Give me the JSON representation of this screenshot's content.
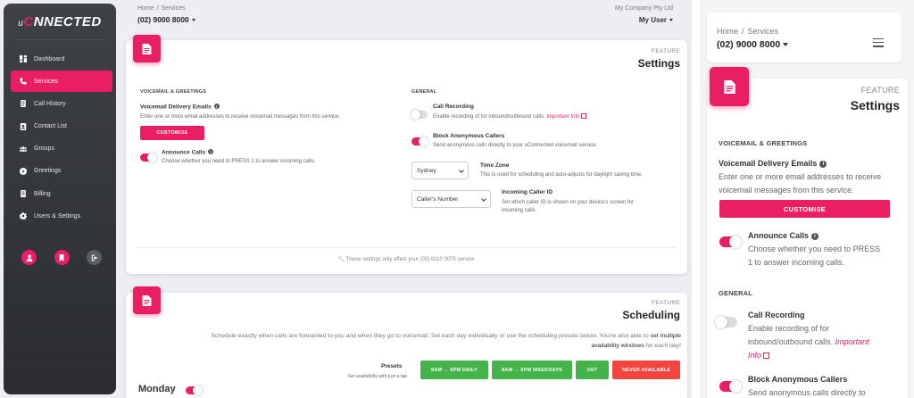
{
  "app": {
    "logo_prefix": "u",
    "logo_ring": "C",
    "logo_rest": "NNECTED"
  },
  "sidebar": {
    "items": [
      {
        "label": "Dashboard",
        "icon": "dashboard-icon",
        "active": false
      },
      {
        "label": "Services",
        "icon": "phone-icon",
        "active": true
      },
      {
        "label": "Call History",
        "icon": "call-history-icon",
        "active": false
      },
      {
        "label": "Contact List",
        "icon": "contact-list-icon",
        "active": false
      },
      {
        "label": "Groups",
        "icon": "groups-icon",
        "active": false
      },
      {
        "label": "Greetings",
        "icon": "play-icon",
        "active": false
      },
      {
        "label": "Billing",
        "icon": "billing-icon",
        "active": false
      },
      {
        "label": "Users & Settings",
        "icon": "gear-icon",
        "active": false
      }
    ],
    "bottom_buttons": [
      "profile-icon",
      "bookmark-icon",
      "logout-icon"
    ]
  },
  "header": {
    "breadcrumb": [
      "Home",
      "Services"
    ],
    "breadcrumb_sep": "/",
    "service_number": "(02) 9000 8000",
    "company": "My Company Pty Ltd",
    "user": "My User"
  },
  "settings_card": {
    "feature_label": "FEATURE",
    "title": "Settings",
    "voicemail_section": "VOICEMAIL & GREETINGS",
    "voicemail_emails_label": "Voicemail Delivery Emails",
    "voicemail_emails_desc": "Enter one or more email addresses to receive voicemail messages from this service.",
    "customise_button": "CUSTOMISE",
    "announce_label": "Announce Calls",
    "announce_desc": "Choose whether you need to PRESS 1 to answer incoming calls.",
    "announce_on": true,
    "general_section": "GENERAL",
    "recording_label": "Call Recording",
    "recording_desc": "Enable recording of for inbound/outbound calls.",
    "recording_link": "Important Info",
    "recording_on": false,
    "block_label": "Block Anonymous Callers",
    "block_desc": "Send anonymous calls directly to your uConnected voicemail service.",
    "block_on": true,
    "timezone_value": "Sydney",
    "timezone_label": "Time Zone",
    "timezone_desc": "This is used for scheduling and auto-adjusts for daylight saving time.",
    "callerid_value": "Caller's Number",
    "callerid_label": "Incoming Caller ID",
    "callerid_desc_1": "Set which caller ID is shown on your device's screen for",
    "callerid_desc_2": "incoming calls.",
    "footnote": "These settings only affect your (03) 9110 3075 service"
  },
  "scheduling_card": {
    "feature_label": "FEATURE",
    "title": "Scheduling",
    "desc_line1": "Schedule exactly when calls are forwarded to you and when they go to voicemail. Set each day individually or use the scheduling presets below. You're also able to",
    "desc_link": "set multiple",
    "desc_line2_link": "availability windows",
    "desc_line2_tail": "for each day!",
    "presets_label": "Presets",
    "presets_sub": "Set availability with just a tap",
    "preset_buttons": [
      "8AM → 6PM DAILY",
      "8AM → 6PM WEEKDAYS",
      "24/7",
      "NEVER AVAILABLE"
    ],
    "day_label": "Monday",
    "day_on": true
  },
  "mobile": {
    "breadcrumb": [
      "Home",
      "Services"
    ],
    "service_number": "(02) 9000 8000",
    "feature_label": "FEATURE",
    "title": "Settings",
    "voicemail_section": "VOICEMAIL & GREETINGS",
    "voicemail_emails_label": "Voicemail Delivery Emails",
    "voicemail_desc_1": "Enter one or more email addresses to receive",
    "voicemail_desc_2": "voicemail messages from this service.",
    "customise_button": "CUSTOMISE",
    "announce_label": "Announce Calls",
    "announce_desc_1": "Choose whether you need to PRESS",
    "announce_desc_2": "1 to answer incoming calls.",
    "general_section": "GENERAL",
    "recording_label": "Call Recording",
    "recording_desc_1": "Enable recording of for",
    "recording_desc_2": "inbound/outbound calls.",
    "recording_link_1": "Important",
    "recording_link_2": "Info",
    "block_label": "Block Anonymous Callers",
    "block_desc_1": "Send anonymous calls directly to"
  },
  "colors": {
    "accent": "#e91e63",
    "sidebar": "#2f3236",
    "green": "#43b34a",
    "red": "#f2453d"
  }
}
